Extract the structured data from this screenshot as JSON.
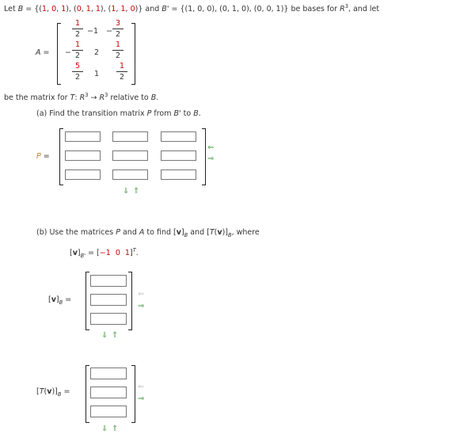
{
  "intro": {
    "let": "Let ",
    "B": "B",
    "eq1": " = {(",
    "b1": [
      "1",
      "0",
      "1"
    ],
    "b2": [
      "0",
      "1",
      "1"
    ],
    "b3": [
      "1",
      "1",
      "0"
    ],
    "and": " and ",
    "Bp": "B'",
    "eq2": " = {(1, 0, 0), (0, 1, 0), (0, 0, 1)} be bases for ",
    "R": "R",
    "exp": "3",
    "tail": ", and let"
  },
  "matrixA": {
    "label": "A =",
    "rows": [
      [
        {
          "sign": "",
          "num": "1",
          "den": "2"
        },
        {
          "int": "−1"
        },
        {
          "sign": "−",
          "num": "3",
          "den": "2"
        }
      ],
      [
        {
          "sign": "−",
          "num": "1",
          "den": "2"
        },
        {
          "int": "2"
        },
        {
          "sign": "",
          "num": "1",
          "den": "2"
        }
      ],
      [
        {
          "sign": "",
          "num": "5",
          "den": "2"
        },
        {
          "int": "1"
        },
        {
          "sign": "",
          "num": "1",
          "den": "2"
        }
      ]
    ]
  },
  "desc": {
    "pre": "be the matrix for ",
    "T": "T",
    "mid": ": R",
    "exp1": "3",
    "arrow": " → R",
    "exp2": "3",
    "post": " relative to ",
    "B": "B",
    "end": "."
  },
  "partA": {
    "pre": "(a) Find the transition matrix ",
    "P": "P",
    "mid": " from ",
    "Bp": "B'",
    "to": " to ",
    "B": "B",
    "end": ".",
    "label": "P =",
    "rows": 3,
    "cols": 3,
    "values": [
      [
        "",
        "",
        ""
      ],
      [
        "",
        "",
        ""
      ],
      [
        "",
        "",
        ""
      ]
    ]
  },
  "partB": {
    "pre": "(b) Use the matrices ",
    "P": "P",
    "and1": " and ",
    "A": "A",
    "find": " to find [",
    "v": "v",
    "close1": "]",
    "subB": "B",
    "and2": " and [",
    "T": "T",
    "open": "(",
    "v2": "v",
    "close2": ")]",
    "subB2": "B",
    "where": ", where",
    "given_open": "[",
    "given_v": "v",
    "given_close": "]",
    "given_sub": "B'",
    "given_eq": " = [",
    "given_vals": [
      "−1",
      "0",
      "1"
    ],
    "given_end": "]",
    "given_T": "T",
    "period": "."
  },
  "vB": {
    "label_open": "[",
    "label_v": "v",
    "label_close": "]",
    "label_sub": "B",
    "label_eq": " =",
    "values": [
      "",
      "",
      ""
    ]
  },
  "TvB": {
    "label_open": "[",
    "label_T": "T",
    "label_paren": "(",
    "label_v": "v",
    "label_close": ")]",
    "label_sub": "B",
    "label_eq": " =",
    "values": [
      "",
      "",
      ""
    ]
  },
  "icons": {
    "arrow_left": "⇐",
    "arrow_right": "⇒",
    "arrow_down": "⇓",
    "arrow_up": "⇑"
  },
  "colors": {
    "accent_red": "#cc0000",
    "arrow_green": "#5aa65a",
    "arrow_gray": "#c8c8c8",
    "input_border": "#777777"
  }
}
